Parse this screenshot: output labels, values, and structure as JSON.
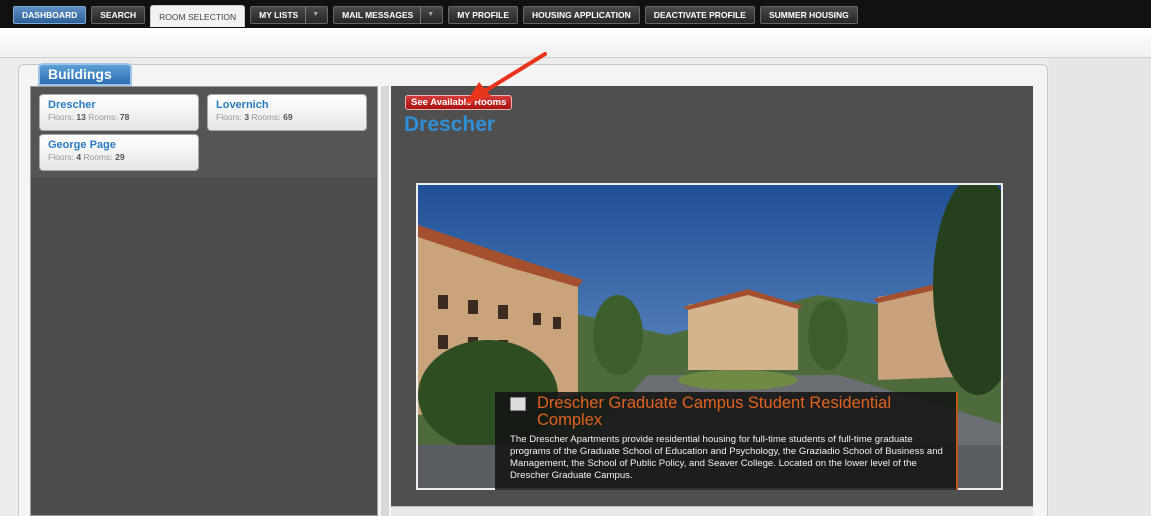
{
  "nav": {
    "tabs": [
      {
        "label": "DASHBOARD"
      },
      {
        "label": "SEARCH"
      },
      {
        "label": "ROOM SELECTION"
      },
      {
        "label": "MY LISTS"
      },
      {
        "label": "MAIL MESSAGES"
      },
      {
        "label": "MY PROFILE"
      },
      {
        "label": "HOUSING APPLICATION"
      },
      {
        "label": "DEACTIVATE PROFILE"
      },
      {
        "label": "SUMMER HOUSING"
      }
    ],
    "caret": "▼"
  },
  "buildings_tab": "Buildings",
  "buildings": [
    {
      "name": "Drescher",
      "floors_label": "Floors:",
      "floors": "13",
      "rooms_label": "Rooms:",
      "rooms": "78"
    },
    {
      "name": "Lovernich",
      "floors_label": "Floors:",
      "floors": "3",
      "rooms_label": "Rooms:",
      "rooms": "69"
    },
    {
      "name": "George Page",
      "floors_label": "Floors:",
      "floors": "4",
      "rooms_label": "Rooms:",
      "rooms": "29"
    }
  ],
  "detail": {
    "see_rooms_button": "See Available Rooms",
    "title": "Drescher",
    "caption_title": "Drescher Graduate Campus Student Residential Complex",
    "caption_text": "The Drescher Apartments provide residential housing for full-time students of full-time graduate programs of the Graduate School of Education and Psychology, the Graziadio School of Business and Management, the School of Public Policy, and Seaver College. Located on the lower level of the Drescher Graduate Campus."
  },
  "colors": {
    "accent_blue": "#2e8fd6",
    "button_red": "#b81e1e",
    "caption_orange": "#e0621e",
    "annotation_arrow": "#e8341c"
  },
  "icons": [
    "arrow-annotation",
    "caption-image-icon"
  ]
}
